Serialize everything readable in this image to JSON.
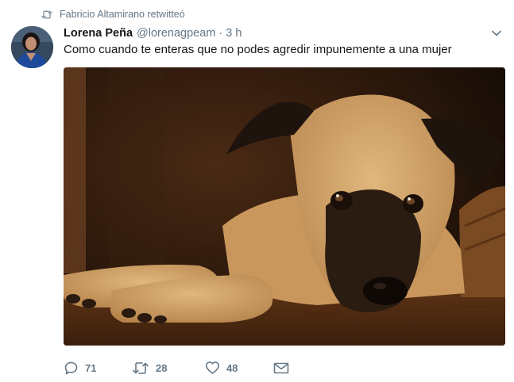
{
  "retweet_context": {
    "icon": "retweet-icon",
    "text": "Fabricio Altamirano retwitteó"
  },
  "tweet": {
    "author": {
      "display_name": "Lorena Peña",
      "handle": "@lorenagpeam",
      "avatar_icon": "avatar-photo"
    },
    "separator": "·",
    "timestamp": "3 h",
    "text": "Como cuando te enteras que no podes agredir impunemente a una mujer",
    "media": {
      "kind": "photo",
      "subject": "dog-photo"
    },
    "actions": {
      "reply_count": "71",
      "retweet_count": "28",
      "like_count": "48"
    }
  },
  "icons": {
    "reply": "reply-icon",
    "retweet": "retweet-icon",
    "like": "heart-icon",
    "message": "envelope-icon",
    "menu": "chevron-down-icon"
  },
  "colors": {
    "text_primary": "#14171a",
    "text_secondary": "#657786",
    "background": "#ffffff"
  }
}
